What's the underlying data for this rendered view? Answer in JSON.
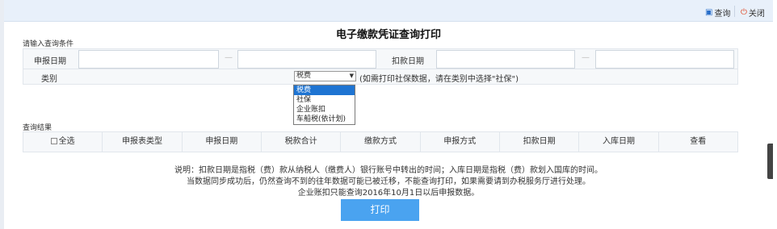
{
  "toolbar": {
    "query_label": "查询",
    "close_label": "关闭"
  },
  "title": "电子缴款凭证查询打印",
  "conditions": {
    "section_label": "请输入查询条件",
    "declare_date_label": "申报日期",
    "deduct_date_label": "扣款日期",
    "category_label": "类别",
    "category_selected": "税费",
    "category_hint": "(如需打印社保数据，请在类别中选择\"社保\")",
    "category_options": [
      "税费",
      "社保",
      "企业账扣",
      "车船税(依计划)"
    ]
  },
  "results": {
    "section_label": "查询结果",
    "select_all_label": "全选",
    "columns": [
      "申报表类型",
      "申报日期",
      "税款合计",
      "缴款方式",
      "申报方式",
      "扣款日期",
      "入库日期",
      "查看"
    ]
  },
  "notes": [
    "说明：扣款日期是指税（费）款从纳税人（缴费人）银行账号中转出的时间；入库日期是指税（费）款划入国库的时间。",
    "当数据同步成功后，仍然查询不到的往年数据可能已被迁移，不能查询打印，如果需要请到办税服务厅进行处理。",
    "企业账扣只能查询2016年10月1日以后申报数据。"
  ],
  "print_label": "打印"
}
